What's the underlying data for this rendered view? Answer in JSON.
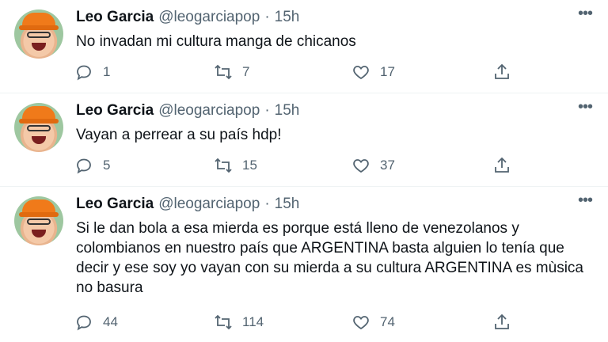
{
  "tweets": [
    {
      "name": "Leo Garcia",
      "handle": "@leogarciapop",
      "dot": "·",
      "time": "15h",
      "text": "No invadan mi cultura manga de chicanos",
      "replies": "1",
      "retweets": "7",
      "likes": "17"
    },
    {
      "name": "Leo Garcia",
      "handle": "@leogarciapop",
      "dot": "·",
      "time": "15h",
      "text": "Vayan a perrear a su país hdp!",
      "replies": "5",
      "retweets": "15",
      "likes": "37"
    },
    {
      "name": "Leo Garcia",
      "handle": "@leogarciapop",
      "dot": "·",
      "time": "15h",
      "text": "Si le dan bola a esa mierda es porque está lleno de venezolanos y colombianos en nuestro país que ARGENTINA basta alguien lo tenía que decir y ese soy yo vayan con su mierda a su cultura ARGENTINA es mùsica no basura",
      "replies": "44",
      "retweets": "114",
      "likes": "74"
    }
  ],
  "icons": {
    "more": "more-horizontal-icon",
    "reply": "reply-icon",
    "retweet": "retweet-icon",
    "like": "heart-icon",
    "share": "share-icon"
  },
  "colors": {
    "text": "#0f1419",
    "secondary": "#536471",
    "divider": "#eff3f4",
    "cap": "#f07a1a"
  }
}
